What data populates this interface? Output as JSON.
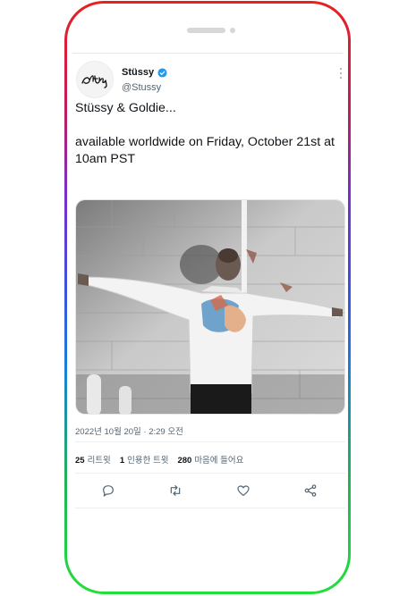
{
  "tweet": {
    "display_name": "Stüssy",
    "handle": "@Stussy",
    "text": "Stüssy & Goldie...\n\navailable worldwide on Friday, October 21st at 10am PST",
    "timestamp": "2022년 10월 20일 · 2:29 오전",
    "media_alt": "Photo: man in white embroidered shirt with arms outstretched against white brick wall"
  },
  "stats": {
    "retweets_count": "25",
    "retweets_label": "리트윗",
    "quotes_count": "1",
    "quotes_label": "인용한 트윗",
    "likes_count": "280",
    "likes_label": "마음에 들어요"
  },
  "icons": {
    "reply": "reply-icon",
    "retweet": "retweet-icon",
    "like": "heart-icon",
    "share": "share-icon",
    "verified": "verified-badge-icon",
    "more": "more-options-icon"
  },
  "colors": {
    "verified": "#1d9bf0",
    "text": "#0f1419",
    "muted": "#536471",
    "frame_top": "#e8201f",
    "frame_bottom": "#22e03a"
  }
}
